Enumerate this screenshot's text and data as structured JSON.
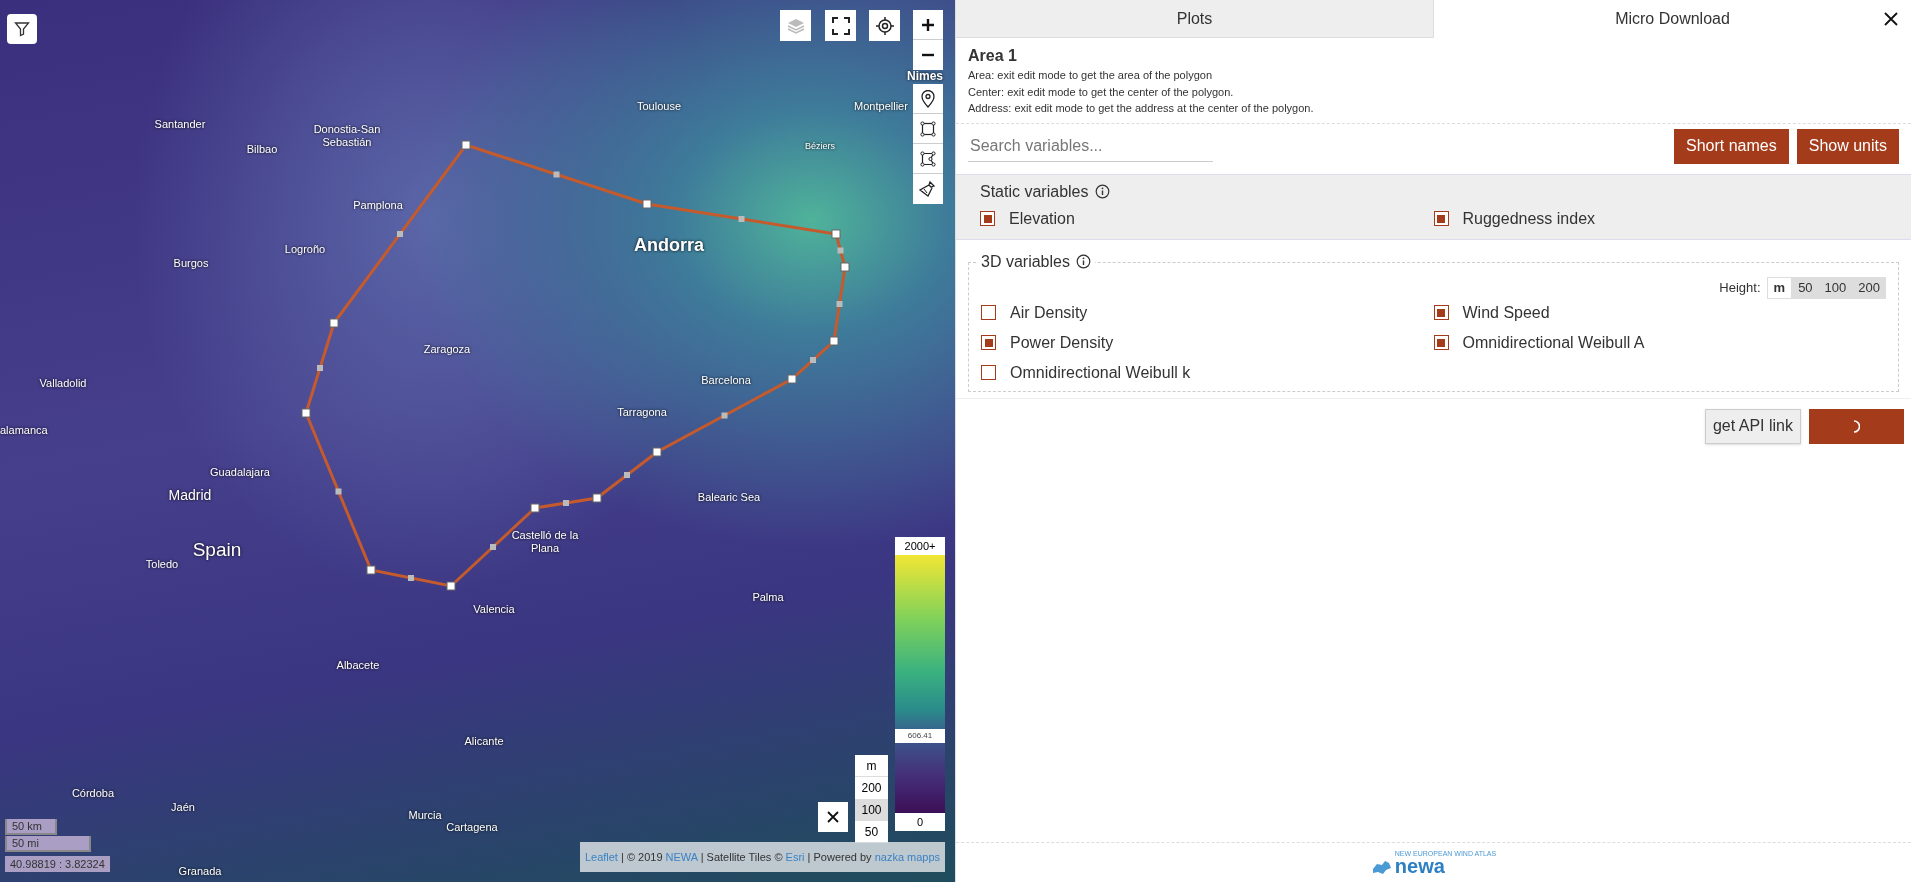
{
  "map": {
    "places": [
      "Nimes",
      "Toulouse",
      "Montpellier",
      "Santander",
      "Donostia-San Sebastián",
      "Bilbao",
      "Béziers",
      "Pamplona",
      "Andorra",
      "Logroño",
      "Burgos",
      "Zaragoza",
      "Barcelona",
      "Valladolid",
      "Tarragona",
      "alamanca",
      "Guadalajara",
      "Balearic Sea",
      "Madrid",
      "Castelló de la Plana",
      "Spain",
      "Toledo",
      "Palma",
      "Valencia",
      "Albacete",
      "Alicante",
      "Córdoba",
      "Jaén",
      "Murcia",
      "Cartagena",
      "Granada"
    ],
    "legend": {
      "max_label": "2000+",
      "marker_value": "606.41",
      "level": 0.3,
      "min_label": "0"
    },
    "height_selector": {
      "unit": "m",
      "options": [
        {
          "label": "200",
          "selected": false
        },
        {
          "label": "100",
          "selected": true
        },
        {
          "label": "50",
          "selected": false
        }
      ]
    },
    "scale": [
      "50 km",
      "50 mi"
    ],
    "coordinates": "40.98819 : 3.82324",
    "attribution": [
      {
        "text": "Leaflet",
        "kind": "link"
      },
      {
        "text": " | © 2019 ",
        "kind": "text"
      },
      {
        "text": "NEWA",
        "kind": "link"
      },
      {
        "text": " | Satellite Tiles © ",
        "kind": "text"
      },
      {
        "text": "Esri",
        "kind": "link"
      },
      {
        "text": " | Powered by ",
        "kind": "text"
      },
      {
        "text": "nazka mapps",
        "kind": "link"
      }
    ]
  },
  "panel": {
    "tabs": [
      {
        "label": "Plots",
        "selected": false
      },
      {
        "label": "Micro Download",
        "selected": true
      }
    ],
    "area": {
      "title": "Area 1",
      "info": [
        "Area: exit edit mode to get the area of the polygon",
        "Center: exit edit mode to get the center of the polygon.",
        "Address: exit edit mode to get the address at the center of the polygon."
      ]
    },
    "search": {
      "placeholder": "Search variables..."
    },
    "buttons": [
      "Short names",
      "Show units"
    ],
    "static_variables": {
      "title": "Static variables",
      "items": [
        {
          "label": "Elevation",
          "checked": true
        },
        {
          "label": "Ruggedness index",
          "checked": true
        }
      ]
    },
    "variables_3d": {
      "title": "3D variables",
      "height_label": "Height:",
      "heights": [
        {
          "label": "m",
          "selected": true
        },
        {
          "label": "50",
          "selected": false
        },
        {
          "label": "100",
          "selected": false
        },
        {
          "label": "200",
          "selected": false
        }
      ],
      "items": [
        {
          "label": "Air Density",
          "checked": false
        },
        {
          "label": "Wind Speed",
          "checked": true
        },
        {
          "label": "Power Density",
          "checked": true
        },
        {
          "label": "Omnidirectional Weibull A",
          "checked": true
        },
        {
          "label": "Omnidirectional Weibull k",
          "checked": false
        }
      ]
    },
    "footer": {
      "api_button": "get API link",
      "download_loading": true
    },
    "logo": {
      "tagline": "NEW EUROPEAN WIND ATLAS",
      "name": "newa"
    }
  }
}
